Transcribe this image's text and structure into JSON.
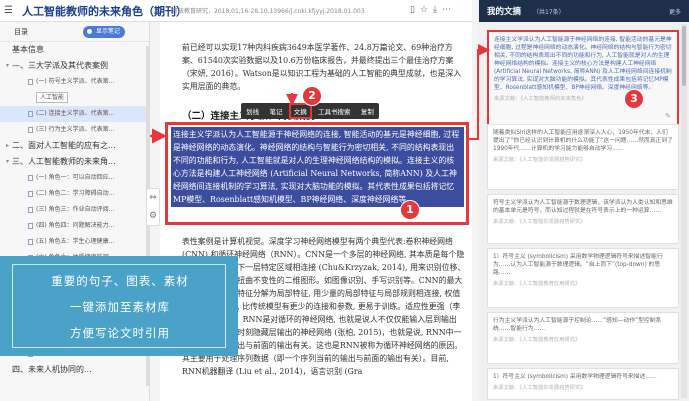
{
  "titlebar": {
    "menu_icon": "list-icon",
    "title": "人工智能教师的未来角色（期刊）",
    "meta": "开放教育研究，2018,01,16-28,10.13966/j.cnki.kfjyyj.2018.01.003",
    "icons": [
      "document-icon",
      "star-icon",
      "download-icon",
      "more-icon"
    ]
  },
  "sidebar": {
    "tab_label": "目录",
    "toggle_label": "显示笔记",
    "items": [
      {
        "level": 1,
        "label": "基本信息"
      },
      {
        "level": 1,
        "label": "—、三大学派及其代表案例",
        "caret": "▾"
      },
      {
        "level": 3,
        "label": "(一) 符号主义学派、代表案..."
      },
      {
        "level": 3,
        "label": "人工智能",
        "tag": true
      },
      {
        "level": 3,
        "label": "(二) 连接主义学派、代表案...",
        "selected": true
      },
      {
        "level": 3,
        "label": "(三) 行为主义学派、代表案..."
      },
      {
        "level": 1,
        "label": "二、面对人工智能的应有之...",
        "caret": "▸"
      },
      {
        "level": 1,
        "label": "三、人工智能教师的未来角...",
        "caret": "▾"
      },
      {
        "level": 3,
        "label": "(一) 角色一：可以自动回应..."
      },
      {
        "level": 3,
        "label": "(二) 角色二：学习障碍自动..."
      },
      {
        "level": 3,
        "label": "(三) 角色三：作业自动评阅..."
      },
      {
        "level": 3,
        "label": "(四) 角色四：问题解决能力..."
      },
      {
        "level": 3,
        "label": "(五) 角色五：学生心理健康..."
      },
      {
        "level": 3,
        "label": "(六) 角色六：体质健康监测..."
      },
      {
        "level": 3,
        "label": "(七) 角色七：学生成长发展..."
      },
      {
        "level": 3,
        "label": "(八) 角色八：个性化智能教..."
      },
      {
        "level": 3,
        "label": "(九) 角色九：学生成长发展..."
      },
      {
        "level": 3,
        "label": "(十) 角色十：教育决策的智..."
      },
      {
        "level": 3,
        "label": "(十一) 角色十一：精准教研..."
      },
      {
        "level": 3,
        "label": "(十二) 角色十二：家校协同..."
      },
      {
        "level": 1,
        "label": "四、未来人机协同的..."
      }
    ]
  },
  "toolbar": {
    "icons": [
      "expand-icon",
      "settings-icon"
    ]
  },
  "document": {
    "para1": "前已经可以实现17种内科疾病3649本医学著作、24.8万篇论文、69种治疗方案、61540次实验数据以及10.6万份临床报告，并最终提出三个最佳治疗方案（宋妍, 2016）。Watson是以知识工程为基础的人工智能的典型成就，也是深入实用层面的典范。",
    "heading": "（二）连接主义学派、代表案例",
    "highlight": "连接主义学派认为人工智能源于神经网络的连接, 智能活动的基元是神经细胞, 过程是神经网络的动态演化。神经网络的结构与智能行为密切相关, 不同的结构表现出不同的功能和行为, 人工智能就是对人的生理神经网络结构的模拟。连接主义的核心方法是构建人工神经网络 (Artificial Neural Networks, 简称ANN) 及人工神经网络间连接机制的学习算法, 实现对大脑功能的模拟。其代表性成果包括将记忆MP模型、Rosenblatt感知机模型、BP神经网络、深度神经网络等。",
    "para3": "表性案例是计算机视觉。深度学习神经网络模型有两个典型代表:卷积神经网络 (CNN) 和循环神经网络（RNN）。CNN是一个多层的神经网络, 其本质是每个隐藏层的神经元和下一层特定区域相连接 (Chu&Krzyzak, 2014), 用来识别位移、缩放及其它形式扭曲不变性的二维图形。如图像识别、手写识别等。CNN的最大优势在于将整体特征分解为局部特征, 用少量的局部特征与局部规则相连接, 权值共享和池化操作, 比传统模型有更少的连接和参数, 更易于训练。适应性更强（李彦冬等, 2016）。RNN是对循环的神经网络, 也就是说人不仅仅能输入层到输出层，还包括上一时刻隐藏层输出的神经网络 (张柏, 2015)，也就是说, RNN中一个序列当前的输出与前面的输出有关。这也是RNN被称为循环神经网络的原因。其主要用于处理序列数据（即一个序列当前的输出与前面的输出有关）。目前, RNN机器翻译 (Liu et al., 2014)，语言识别 (Gra"
  },
  "context_menu": {
    "items": [
      "划线",
      "笔记",
      "文摘",
      "工具书搜索",
      "复制"
    ],
    "active_index": 2
  },
  "badges": [
    "1",
    "2",
    "3"
  ],
  "banner": {
    "lines": [
      "重要的句子、图表、素材",
      "一键添加至素材库",
      "方便写论文时引用"
    ]
  },
  "right_panel": {
    "title": "我的文摘",
    "count": "（共17条）",
    "more": "更多",
    "notes": [
      {
        "text": "连接主义学派认为人工智能源于神经网络的连接, 智能活动的基元是神经细胞, 过程是神经网络的动态演化。神经网络的结构与智能行为密切相关, 不同的结构表现出不同的功能和行为, 人工智能就是对人的生理神经网络结构的模拟。连接主义的核心方法是构建人工神经网络 (Artificial Neural Networks, 简称ANN) 及人工神经网络间连接机制的学习算法, 实现对大脑功能的模拟。其代表性成果包括将记忆MP模型、Rosenblatt感知机模型、BP神经网络、深度神经网络等。",
        "source": "来源文献：《人工智能教师的未来角色》"
      },
      {
        "text": "随着类似Siri这样的人工智能应用逐渐深入人心，1950年代末，人们提出了“你已经认识到计算机的什么功能了”这一问题……然而真正到了1990年代……计算机的学习能力能够自动学习……",
        "source": "来源文献：《人工智能的发展趋势研究》"
      },
      {
        "text": "符号主义学派认为人工智能源于数理逻辑，该学派认为人类认知和思维的基本单元是符号，而认知过程就是在符号表示上的一种运算……",
        "source": "来源文献：《人工智能的发展趋势研究》"
      },
      {
        "text": "1）符号主义 (symbolicism) 采用数学物理逻辑符号来描述智能行为……认为人工智能源于数理逻辑。“自上而下”(top-down) 的思路……",
        "source": "来源文献：《人工智能教育应用研究》"
      },
      {
        "text": "行为主义学派认为人工智能源于控制论……“感知—动作”型控制系统……智能行为……",
        "source": "来源文献：《人工智能教育应用研究》"
      },
      {
        "text": "1）符号主义 (symbolicism) 采用数学物理逻辑符号来描述……",
        "source": "来源文献：《人工智能的发展趋势研究》"
      }
    ]
  }
}
